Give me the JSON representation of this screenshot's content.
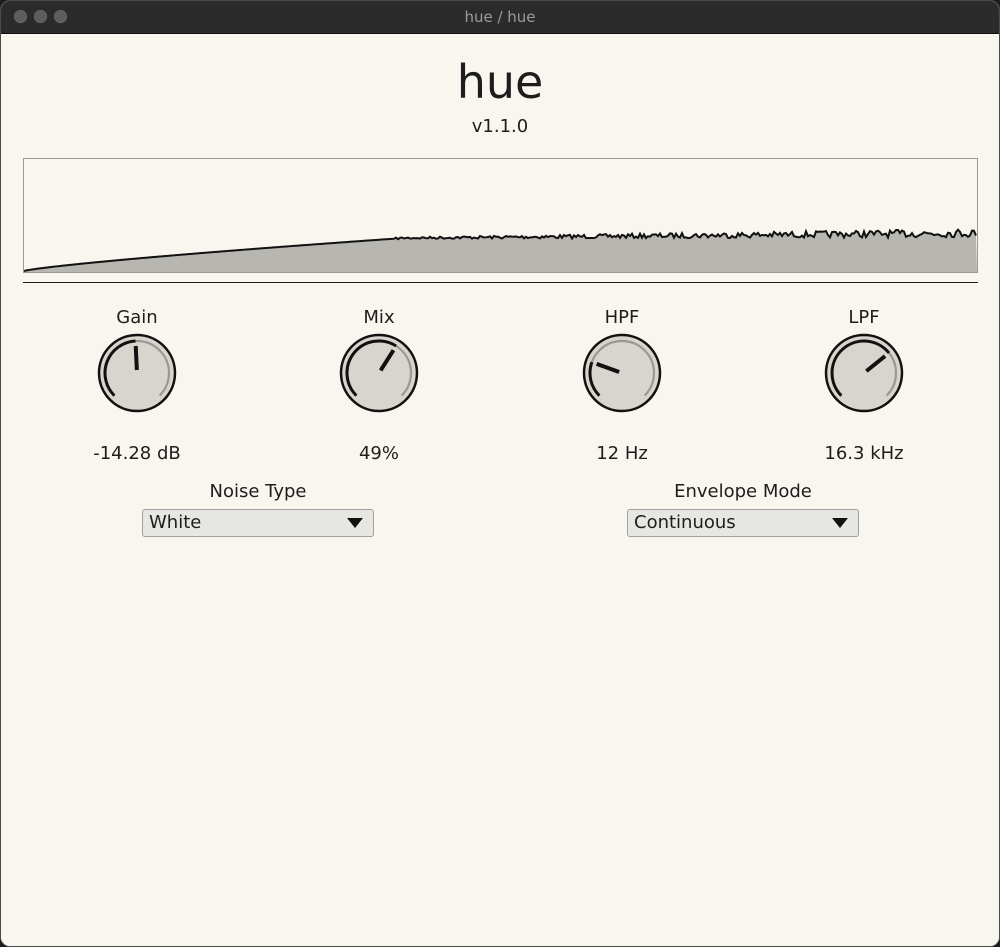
{
  "window": {
    "title": "hue / hue"
  },
  "app": {
    "name": "hue",
    "version": "v1.1.0"
  },
  "knobs": [
    {
      "label": "Gain",
      "value": "-14.28 dB",
      "fraction": 0.49
    },
    {
      "label": "Mix",
      "value": "49%",
      "fraction": 0.62
    },
    {
      "label": "HPF",
      "value": "12 Hz",
      "fraction": 0.24
    },
    {
      "label": "LPF",
      "value": "16.3 kHz",
      "fraction": 0.69
    }
  ],
  "noise_type": {
    "label": "Noise Type",
    "selected": "White"
  },
  "envelope_mode": {
    "label": "Envelope Mode",
    "selected": "Continuous"
  },
  "colors": {
    "background": "#f8f6ee",
    "spectrum_fill": "#b7b6b0",
    "knob_face": "#d7d5ce",
    "knob_arc": "#999892",
    "ink": "#111111"
  }
}
